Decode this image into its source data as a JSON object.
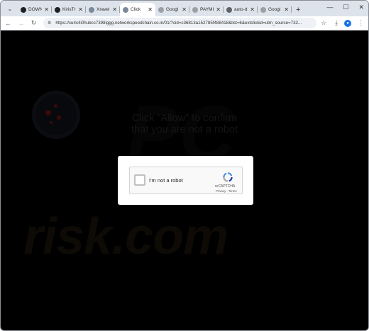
{
  "browser": {
    "tabs": [
      {
        "title": "DOWN",
        "fav_color": "#202124",
        "fav_glyph": "●"
      },
      {
        "title": "KirisTr",
        "fav_color": "#202124",
        "fav_glyph": "●"
      },
      {
        "title": "Xravel",
        "fav_color": "#7a8a99",
        "fav_glyph": "◌"
      },
      {
        "title": "Click",
        "fav_color": "#7a8a99",
        "fav_glyph": "◌",
        "active": true
      },
      {
        "title": "Googl",
        "fav_color": "#9aa0a6",
        "fav_glyph": "▦"
      },
      {
        "title": "PAYMI",
        "fav_color": "#9aa0a6",
        "fav_glyph": "▭"
      },
      {
        "title": "auto-d",
        "fav_color": "#5f6368",
        "fav_glyph": "⊕"
      },
      {
        "title": "Googl",
        "fav_color": "#9aa0a6",
        "fav_glyph": "▦"
      }
    ],
    "new_tab": "+",
    "controls": {
      "minimize": "—",
      "maximize": "☐",
      "close": "✕"
    },
    "url": "https://cu4c4i0hubcc7398iggg.networkspeedchain.co.in/01/?cid=c36813a152785f488418&list=6&extclickid=utm_source=732..."
  },
  "page": {
    "headline_line1": "Click \"Allow\" to confirm",
    "headline_line2": "that you are not a robot",
    "watermark_text": "risk.com",
    "watermark_letters": "PC"
  },
  "captcha": {
    "checkbox_label": "I'm not a robot",
    "brand": "reCAPTCHA",
    "privacy": "Privacy",
    "separator": " - ",
    "terms": "Terms"
  }
}
